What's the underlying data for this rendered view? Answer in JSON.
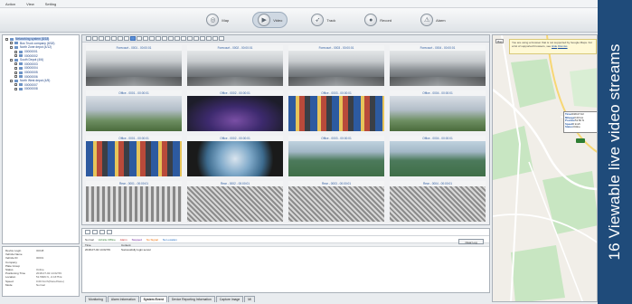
{
  "menu": [
    "Action",
    "View",
    "Setting"
  ],
  "toolbar": [
    {
      "label": "Map",
      "icon": "map-icon",
      "active": false
    },
    {
      "label": "Video",
      "icon": "video-icon",
      "active": true
    },
    {
      "label": "Track",
      "icon": "track-icon",
      "active": false
    },
    {
      "label": "Record",
      "icon": "record-icon",
      "active": false
    },
    {
      "label": "Alarm",
      "icon": "alarm-icon",
      "active": false
    }
  ],
  "tree": [
    {
      "label": "Networking system (8/18)",
      "level": 0,
      "selected": true
    },
    {
      "label": "Bus Truck company (8/18)",
      "level": 1
    },
    {
      "label": "North Zone depot (4/12)",
      "level": 1
    },
    {
      "label": "00000001",
      "level": 2
    },
    {
      "label": "00000002",
      "level": 2
    },
    {
      "label": "South Depot (4/6)",
      "level": 1
    },
    {
      "label": "00000003",
      "level": 2
    },
    {
      "label": "00000004",
      "level": 2
    },
    {
      "label": "00000005",
      "level": 2
    },
    {
      "label": "00000006",
      "level": 2
    },
    {
      "label": "North West depot (4/5)",
      "level": 1
    },
    {
      "label": "00000007",
      "level": 2
    },
    {
      "label": "00000008",
      "level": 2
    }
  ],
  "info": [
    {
      "k": "Device Login",
      "v": "00048"
    },
    {
      "k": "Vehicle Name",
      "v": ""
    },
    {
      "k": "Vehicle ID",
      "v": "00001"
    },
    {
      "k": "Company",
      "v": ""
    },
    {
      "k": "Plate Group",
      "v": ""
    },
    {
      "k": "Status",
      "v": "Online"
    },
    {
      "k": "Positioning Time",
      "v": "2018-07-02 14:02:59"
    },
    {
      "k": "Location",
      "v": "51.5609 N, -0.1675 E"
    },
    {
      "k": "Speed",
      "v": "0.00 Km/h(None/None)"
    },
    {
      "k": "Mode",
      "v": "Normal"
    }
  ],
  "tiles": [
    {
      "title": "Forecourt - 0001 - 00:00:01",
      "scene": "fb"
    },
    {
      "title": "Forecourt - 0002 - 00:00:01",
      "scene": "fb"
    },
    {
      "title": "Forecourt - 0003 - 00:00:01",
      "scene": "fb"
    },
    {
      "title": "Forecourt - 0004 - 00:00:01",
      "scene": "fb"
    },
    {
      "title": "Office - 0001 - 00:00:01",
      "scene": "ro2"
    },
    {
      "title": "Office - 0002 - 00:00:01",
      "scene": "wh"
    },
    {
      "title": "Office - 0003 - 00:00:01",
      "scene": "sh"
    },
    {
      "title": "Office - 0004 - 00:00:01",
      "scene": "ro2"
    },
    {
      "title": "Office - 0001 - 00:00:01",
      "scene": "sh"
    },
    {
      "title": "Office - 0002 - 00:00:01",
      "scene": "ti"
    },
    {
      "title": "Office - 0003 - 00:00:01",
      "scene": "ro"
    },
    {
      "title": "Office - 0004 - 00:00:01",
      "scene": "ro"
    },
    {
      "title": "Rear - 0001 - 00:00:01",
      "scene": "ne"
    },
    {
      "title": "Rear - 0002 - 00:00:01",
      "scene": "ne2"
    },
    {
      "title": "Rear - 0003 - 00:00:01",
      "scene": "ne2"
    },
    {
      "title": "Rear - 0004 - 00:00:01",
      "scene": "ne2"
    }
  ],
  "log": {
    "filters": [
      {
        "label": "Normal",
        "color": "#333333"
      },
      {
        "label": "Vehicle Offline",
        "color": "#2e7d32"
      },
      {
        "label": "Alarm",
        "color": "#c62828"
      },
      {
        "label": "Stopped",
        "color": "#6a1b9a"
      },
      {
        "label": "No Signal",
        "color": "#ef6c00"
      },
      {
        "label": "No Location",
        "color": "#1565c0"
      }
    ],
    "columns": [
      "Time",
      "Content"
    ],
    "rows": [
      {
        "time": "2018-07-02 14:02:59",
        "content": "Successfully login server"
      }
    ],
    "button": "Clear Log"
  },
  "tabs": [
    {
      "label": "Monitoring",
      "active": false
    },
    {
      "label": "Alarm Information",
      "active": false
    },
    {
      "label": "System Event",
      "active": true
    },
    {
      "label": "Device Reporting Information",
      "active": false
    },
    {
      "label": "Capture Image",
      "active": false
    },
    {
      "label": "Mi",
      "active": false
    }
  ],
  "map": {
    "zoom": "Map",
    "notice": "You are using a browser that is not supported by Google Maps. For a list of supported browsers, see",
    "notice_link": "Hide",
    "notice_link2": "Dismiss",
    "popup": [
      {
        "k": "Time",
        "v": "2018-07-02"
      },
      {
        "k": "Mileage",
        "v": "0.00 km"
      },
      {
        "k": "Position",
        "v": "51.56 N"
      },
      {
        "k": "Speed",
        "v": "0 km/h"
      },
      {
        "k": "Status",
        "v": "Online"
      }
    ],
    "marker_label": "00000001"
  },
  "caption": "16 Viewable live video streams"
}
